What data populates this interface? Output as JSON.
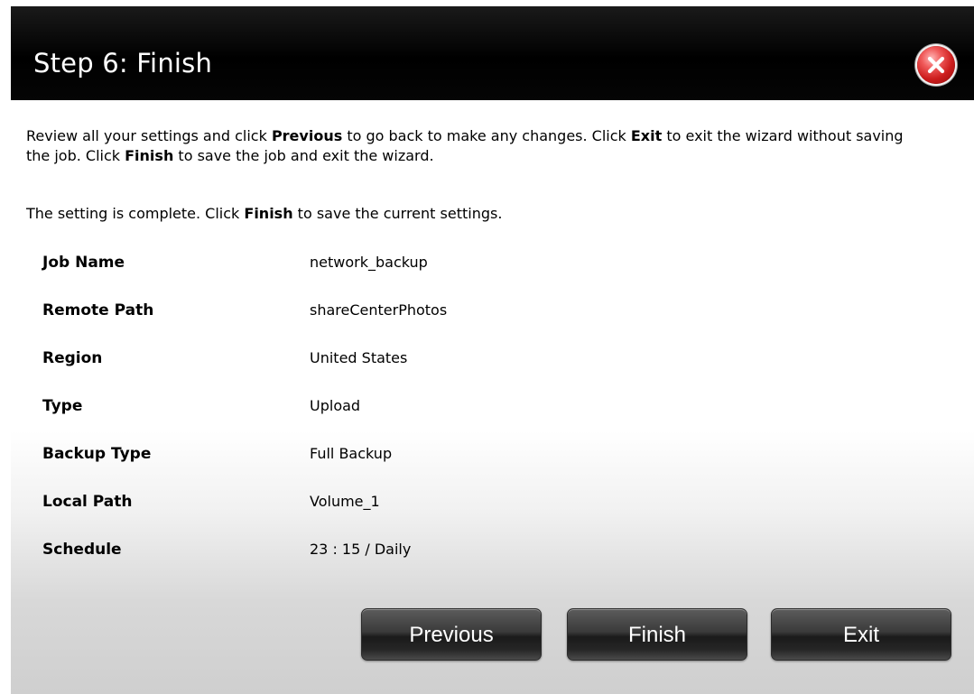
{
  "dialog": {
    "title": "Step 6: Finish"
  },
  "instructions": {
    "part1": "Review all your settings and click ",
    "previous_bold": "Previous",
    "part2": " to go back to make any changes. Click ",
    "exit_bold": "Exit",
    "part3": " to exit the wizard without saving the job. Click ",
    "finish_bold": "Finish",
    "part4": " to save the job and exit the wizard."
  },
  "note": {
    "part1": "The setting is complete. Click ",
    "finish_bold": "Finish",
    "part2": " to save the current settings."
  },
  "settings": [
    {
      "label": "Job Name",
      "value": "network_backup"
    },
    {
      "label": "Remote Path",
      "value": "shareCenterPhotos"
    },
    {
      "label": "Region",
      "value": "United States"
    },
    {
      "label": "Type",
      "value": "Upload"
    },
    {
      "label": "Backup Type",
      "value": "Full Backup"
    },
    {
      "label": "Local Path",
      "value": "Volume_1"
    },
    {
      "label": "Schedule",
      "value": "23 : 15 / Daily"
    }
  ],
  "buttons": {
    "previous": "Previous",
    "finish": "Finish",
    "exit": "Exit"
  },
  "icons": {
    "close": "close-icon"
  },
  "colors": {
    "titlebar": "#000000",
    "close_button": "#d62828",
    "button_bg": "#2a2a2a"
  }
}
